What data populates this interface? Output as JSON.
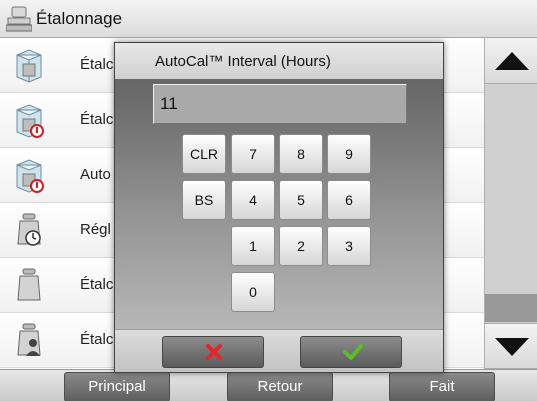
{
  "header": {
    "title": "Étalonnage",
    "icon": "scale-icon"
  },
  "list": {
    "items": [
      {
        "label": "Étalc",
        "icon": "calibration-cube-icon"
      },
      {
        "label": "Étalc",
        "icon": "calibration-cube-warning-icon"
      },
      {
        "label": "Auto",
        "icon": "autocal-warning-icon"
      },
      {
        "label": "Régl",
        "icon": "weight-clock-icon"
      },
      {
        "label": "Étalc",
        "icon": "weight-icon"
      },
      {
        "label": "Étalc",
        "icon": "weight-user-icon"
      }
    ]
  },
  "scrollbar": {
    "up": "arrow-up-icon",
    "down": "arrow-down-icon"
  },
  "dialog": {
    "title": "AutoCal™ Interval (Hours)",
    "value": "11",
    "keys": {
      "clr": "CLR",
      "bs": "BS",
      "k7": "7",
      "k8": "8",
      "k9": "9",
      "k4": "4",
      "k5": "5",
      "k6": "6",
      "k1": "1",
      "k2": "2",
      "k3": "3",
      "k0": "0"
    },
    "cancel_icon": "x-icon",
    "ok_icon": "checkmark-icon",
    "colors": {
      "cancel": "#e8232a",
      "ok": "#58c024"
    }
  },
  "footer": {
    "main": "Principal",
    "back": "Retour",
    "done": "Fait"
  }
}
